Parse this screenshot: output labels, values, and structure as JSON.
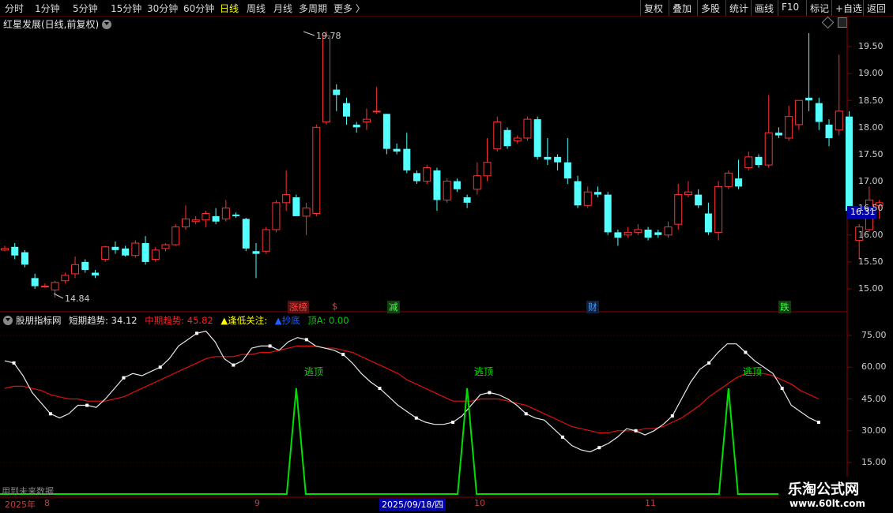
{
  "toolbar": {
    "periods": [
      "分时",
      "1分钟",
      "5分钟",
      "15分钟",
      "30分钟",
      "60分钟",
      "日线",
      "周线",
      "月线",
      "多周期",
      "更多 〉"
    ],
    "active_period": "日线",
    "actions": [
      "复权",
      "叠加",
      "多股",
      "统计",
      "画线",
      "F10",
      "标记",
      "+自选",
      "返回"
    ]
  },
  "stock": {
    "title": "红星发展(日线,前复权)",
    "high_mark": "19.78",
    "low_mark": "14.84",
    "last_price": "16.31"
  },
  "price_axis": [
    "19.50",
    "19.00",
    "18.50",
    "18.00",
    "17.50",
    "17.00",
    "16.50",
    "16.00",
    "15.50",
    "15.00"
  ],
  "events": [
    {
      "text": "涨榜",
      "color": "#ff4040",
      "bg": "#5a1010"
    },
    {
      "text": "$",
      "color": "#ff3030",
      "bg": "none"
    },
    {
      "text": "减",
      "color": "#40ff40",
      "bg": "#104010"
    },
    {
      "text": "财",
      "color": "#40a0ff",
      "bg": "#102040"
    },
    {
      "text": "跌",
      "color": "#40ff40",
      "bg": "#104010"
    }
  ],
  "indicator": {
    "name": "股朋指标网",
    "items": [
      {
        "label": "短期趋势: 34.12",
        "color": "#e8e8e8"
      },
      {
        "label": "中期趋势: 45.82",
        "color": "#ff2020"
      },
      {
        "label": "▲逢低关注:",
        "color": "#ffff00"
      },
      {
        "label": "▲抄底",
        "color": "#2060ff"
      },
      {
        "label": "顶A: 0.00",
        "color": "#00d000"
      }
    ],
    "axis": [
      "75.00",
      "60.00",
      "45.00",
      "30.00",
      "15.00"
    ],
    "signal_text": "逃顶",
    "future_note": "用到未来数据"
  },
  "time_axis": {
    "year": "2025年",
    "months": [
      "8",
      "9",
      "10",
      "11"
    ],
    "cursor_date": "2025/09/18/四"
  },
  "watermark": {
    "name": "乐淘公式网",
    "url": "www.60lt.com"
  },
  "chart_data": {
    "type": "candlestick",
    "price_range": [
      14.7,
      19.95
    ],
    "candles": [
      [
        15.72,
        15.75,
        15.7,
        15.8
      ],
      [
        15.78,
        15.62,
        15.55,
        15.85
      ],
      [
        15.68,
        15.45,
        15.4,
        15.72
      ],
      [
        15.2,
        15.05,
        15.0,
        15.28
      ],
      [
        15.05,
        15.05,
        15.02,
        15.1
      ],
      [
        14.98,
        15.12,
        14.84,
        15.15
      ],
      [
        15.15,
        15.25,
        15.1,
        15.3
      ],
      [
        15.28,
        15.45,
        15.2,
        15.6
      ],
      [
        15.5,
        15.35,
        15.3,
        15.55
      ],
      [
        15.3,
        15.25,
        15.2,
        15.35
      ],
      [
        15.55,
        15.78,
        15.5,
        15.8
      ],
      [
        15.78,
        15.72,
        15.65,
        15.88
      ],
      [
        15.75,
        15.62,
        15.6,
        15.8
      ],
      [
        15.62,
        15.85,
        15.58,
        15.9
      ],
      [
        15.85,
        15.5,
        15.45,
        15.98
      ],
      [
        15.55,
        15.72,
        15.5,
        15.78
      ],
      [
        15.75,
        15.82,
        15.7,
        15.85
      ],
      [
        15.82,
        16.15,
        15.8,
        16.2
      ],
      [
        16.15,
        16.3,
        16.1,
        16.55
      ],
      [
        16.25,
        16.28,
        16.2,
        16.35
      ],
      [
        16.28,
        16.4,
        16.15,
        16.45
      ],
      [
        16.35,
        16.25,
        16.2,
        16.5
      ],
      [
        16.3,
        16.5,
        16.25,
        16.65
      ],
      [
        16.38,
        16.35,
        16.32,
        16.42
      ],
      [
        16.3,
        15.75,
        15.7,
        16.32
      ],
      [
        15.7,
        15.65,
        15.2,
        15.85
      ],
      [
        15.7,
        16.1,
        15.65,
        16.15
      ],
      [
        16.1,
        16.6,
        16.05,
        16.65
      ],
      [
        16.6,
        16.75,
        16.45,
        17.2
      ],
      [
        16.7,
        16.35,
        16.35,
        16.75
      ],
      [
        16.35,
        16.5,
        16.0,
        16.6
      ],
      [
        16.4,
        18.0,
        16.35,
        18.05
      ],
      [
        18.1,
        19.7,
        18.05,
        19.78
      ],
      [
        18.7,
        18.6,
        18.3,
        18.8
      ],
      [
        18.45,
        18.2,
        18.05,
        18.55
      ],
      [
        18.05,
        18.0,
        17.9,
        18.1
      ],
      [
        18.1,
        18.15,
        17.95,
        18.35
      ],
      [
        18.3,
        18.3,
        18.25,
        18.75
      ],
      [
        18.25,
        17.6,
        17.5,
        18.25
      ],
      [
        17.6,
        17.55,
        17.5,
        17.7
      ],
      [
        17.6,
        17.2,
        17.15,
        17.9
      ],
      [
        17.15,
        17.0,
        16.95,
        17.2
      ],
      [
        17.0,
        17.25,
        16.95,
        17.3
      ],
      [
        17.2,
        16.65,
        16.45,
        17.25
      ],
      [
        16.65,
        17.0,
        16.6,
        17.05
      ],
      [
        17.0,
        16.85,
        16.8,
        17.05
      ],
      [
        16.7,
        16.6,
        16.5,
        16.75
      ],
      [
        16.85,
        17.1,
        16.75,
        17.35
      ],
      [
        17.1,
        17.35,
        17.0,
        17.8
      ],
      [
        17.6,
        18.1,
        17.55,
        18.2
      ],
      [
        17.95,
        17.65,
        17.6,
        18.0
      ],
      [
        17.75,
        17.8,
        17.7,
        17.85
      ],
      [
        17.8,
        18.15,
        17.75,
        18.2
      ],
      [
        18.15,
        17.45,
        17.4,
        18.2
      ],
      [
        17.45,
        17.4,
        17.3,
        17.8
      ],
      [
        17.45,
        17.35,
        17.2,
        17.5
      ],
      [
        17.35,
        17.05,
        16.95,
        17.8
      ],
      [
        17.0,
        16.55,
        16.5,
        17.1
      ],
      [
        16.55,
        16.8,
        16.5,
        16.9
      ],
      [
        16.8,
        16.75,
        16.7,
        16.9
      ],
      [
        16.75,
        16.05,
        16.0,
        16.8
      ],
      [
        16.05,
        15.95,
        15.8,
        16.1
      ],
      [
        16.0,
        16.05,
        15.95,
        16.15
      ],
      [
        16.05,
        16.1,
        16.0,
        16.2
      ],
      [
        16.1,
        15.95,
        15.9,
        16.15
      ],
      [
        16.05,
        16.0,
        15.95,
        16.1
      ],
      [
        16.0,
        16.15,
        15.95,
        16.25
      ],
      [
        16.2,
        16.75,
        16.1,
        16.95
      ],
      [
        16.75,
        16.8,
        16.7,
        17.0
      ],
      [
        16.75,
        16.55,
        16.5,
        16.85
      ],
      [
        16.4,
        16.05,
        16.0,
        16.6
      ],
      [
        16.05,
        16.9,
        15.9,
        17.0
      ],
      [
        16.9,
        17.15,
        16.85,
        17.2
      ],
      [
        17.05,
        16.9,
        16.85,
        17.4
      ],
      [
        17.25,
        17.45,
        17.2,
        17.55
      ],
      [
        17.45,
        17.3,
        17.25,
        17.5
      ],
      [
        17.3,
        17.9,
        17.25,
        18.6
      ],
      [
        17.9,
        17.85,
        17.8,
        18.0
      ],
      [
        17.8,
        18.2,
        17.75,
        18.4
      ],
      [
        18.05,
        18.5,
        17.95,
        18.5
      ],
      [
        18.55,
        18.5,
        18.3,
        19.75
      ],
      [
        18.45,
        18.1,
        17.95,
        18.55
      ],
      [
        18.05,
        17.8,
        17.65,
        18.15
      ],
      [
        17.95,
        18.3,
        17.85,
        19.35
      ],
      [
        18.2,
        16.45,
        16.4,
        18.3
      ],
      [
        15.9,
        16.15,
        15.55,
        16.2
      ],
      [
        16.1,
        16.65,
        16.05,
        16.9
      ],
      [
        16.55,
        16.6,
        16.3,
        16.65
      ]
    ],
    "indicator_range": [
      10,
      80
    ],
    "short_trend": [
      63,
      62,
      56,
      48,
      43,
      38,
      36,
      38,
      42,
      42,
      41,
      45,
      50,
      55,
      57,
      56,
      58,
      60,
      64,
      70,
      73,
      76,
      77,
      72,
      64,
      61,
      63,
      69,
      70,
      70,
      68,
      72,
      74,
      73,
      70,
      69,
      68,
      66,
      62,
      57,
      53,
      50,
      46,
      42,
      39,
      36,
      34,
      33,
      33,
      34,
      37,
      42,
      47,
      48,
      47,
      45,
      42,
      38,
      36,
      35,
      31,
      27,
      23,
      21,
      20,
      22,
      24,
      27,
      31,
      30,
      28,
      30,
      33,
      37,
      45,
      53,
      59,
      62,
      67,
      71,
      71,
      67,
      63,
      60,
      57,
      50,
      42,
      39,
      36,
      34
    ],
    "mid_trend": [
      50,
      51,
      51,
      50,
      49,
      47,
      46,
      45,
      45,
      44,
      44,
      44,
      45,
      46,
      48,
      50,
      52,
      54,
      56,
      58,
      60,
      62,
      64,
      65,
      65,
      65,
      66,
      66,
      67,
      67,
      68,
      69,
      70,
      70,
      70,
      69,
      69,
      68,
      67,
      65,
      63,
      61,
      59,
      57,
      54,
      52,
      50,
      48,
      46,
      44,
      44,
      44,
      45,
      45,
      45,
      44,
      43,
      42,
      40,
      38,
      36,
      34,
      32,
      31,
      30,
      29,
      29,
      30,
      30,
      30,
      31,
      31,
      32,
      34,
      36,
      39,
      42,
      46,
      49,
      52,
      55,
      57,
      57,
      57,
      56,
      54,
      52,
      49,
      47,
      45
    ],
    "top_signals": [
      29,
      46,
      72
    ],
    "signal_value": 50
  }
}
